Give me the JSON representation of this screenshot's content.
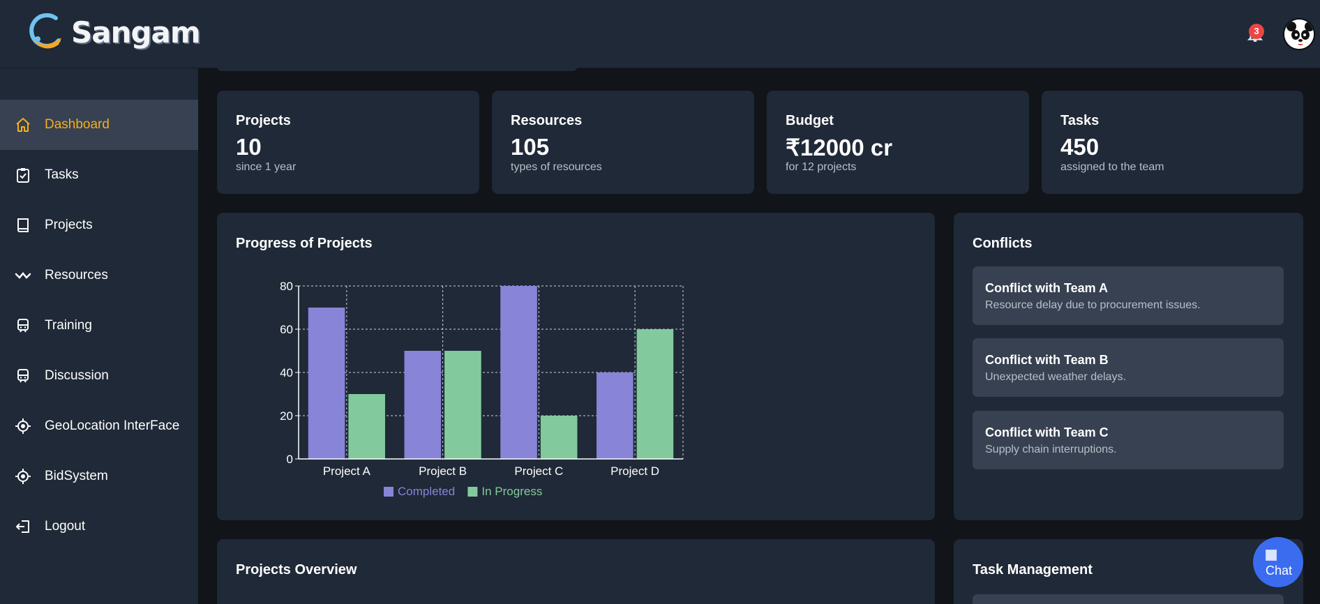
{
  "app": {
    "name": "Sangam",
    "notification_count": "3"
  },
  "sidebar": {
    "items": [
      {
        "label": "Dashboard",
        "icon": "home-icon"
      },
      {
        "label": "Tasks",
        "icon": "clipboard-check-icon"
      },
      {
        "label": "Projects",
        "icon": "book-icon"
      },
      {
        "label": "Resources",
        "icon": "wave-icon"
      },
      {
        "label": "Training",
        "icon": "train-icon"
      },
      {
        "label": "Discussion",
        "icon": "train-icon"
      },
      {
        "label": "GeoLocation InterFace",
        "icon": "target-icon"
      },
      {
        "label": "BidSystem",
        "icon": "target-icon"
      },
      {
        "label": "Logout",
        "icon": "logout-icon"
      }
    ]
  },
  "stats": [
    {
      "title": "Projects",
      "value": "10",
      "sub": "since 1 year"
    },
    {
      "title": "Resources",
      "value": "105",
      "sub": "types of resources"
    },
    {
      "title": "Budget",
      "value": "₹12000 cr",
      "sub": "for 12 projects"
    },
    {
      "title": "Tasks",
      "value": "450",
      "sub": "assigned to the team"
    }
  ],
  "progress_panel": {
    "title": "Progress of Projects"
  },
  "chart_data": {
    "type": "bar",
    "categories": [
      "Project A",
      "Project B",
      "Project C",
      "Project D"
    ],
    "series": [
      {
        "name": "Completed",
        "values": [
          70,
          50,
          80,
          40
        ],
        "color": "#8884d8"
      },
      {
        "name": "In Progress",
        "values": [
          30,
          50,
          20,
          60
        ],
        "color": "#82ca9d"
      }
    ],
    "ylim": [
      0,
      80
    ],
    "yticks": [
      "0",
      "20",
      "40",
      "60",
      "80"
    ],
    "grid": true,
    "legend": "bottom"
  },
  "conflicts": {
    "title": "Conflicts",
    "items": [
      {
        "title": "Conflict with Team A",
        "desc": "Resource delay due to procurement issues."
      },
      {
        "title": "Conflict with Team B",
        "desc": "Unexpected weather delays."
      },
      {
        "title": "Conflict with Team C",
        "desc": "Supply chain interruptions."
      }
    ]
  },
  "overview": {
    "title": "Projects Overview"
  },
  "task_mgmt": {
    "title": "Task Management"
  },
  "chat": {
    "label": "Chat"
  }
}
